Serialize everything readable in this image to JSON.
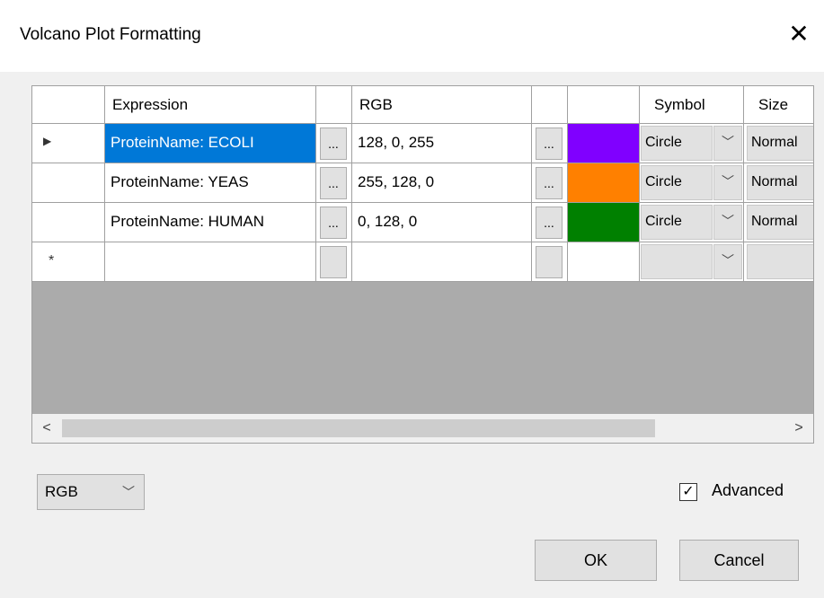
{
  "window": {
    "title": "Volcano Plot Formatting",
    "close_glyph": "✕"
  },
  "grid": {
    "headers": {
      "expression": "Expression",
      "rgb": "RGB",
      "symbol": "Symbol",
      "size": "Size"
    },
    "ellipsis": "...",
    "rows": [
      {
        "expression": "ProteinName: ECOLI",
        "rgb": "128, 0, 255",
        "color": "#8000ff",
        "symbol": "Circle",
        "size": "Normal",
        "selected": true
      },
      {
        "expression": "ProteinName: YEAS",
        "rgb": "255, 128, 0",
        "color": "#ff8000",
        "symbol": "Circle",
        "size": "Normal"
      },
      {
        "expression": "ProteinName: HUMAN",
        "rgb": "0, 128, 0",
        "color": "#008000",
        "symbol": "Circle",
        "size": "Normal"
      }
    ],
    "new_row_marker": "*",
    "current_row_marker": "▶",
    "combo_arrow": "﹀"
  },
  "scrollbar": {
    "left": "<",
    "right": ">"
  },
  "color_mode": {
    "selected": "RGB"
  },
  "advanced": {
    "label": "Advanced",
    "checked": true,
    "check_glyph": "✓"
  },
  "buttons": {
    "ok": "OK",
    "cancel": "Cancel"
  },
  "colors": {
    "selection": "#0078d7",
    "grid_background": "#ababab"
  }
}
